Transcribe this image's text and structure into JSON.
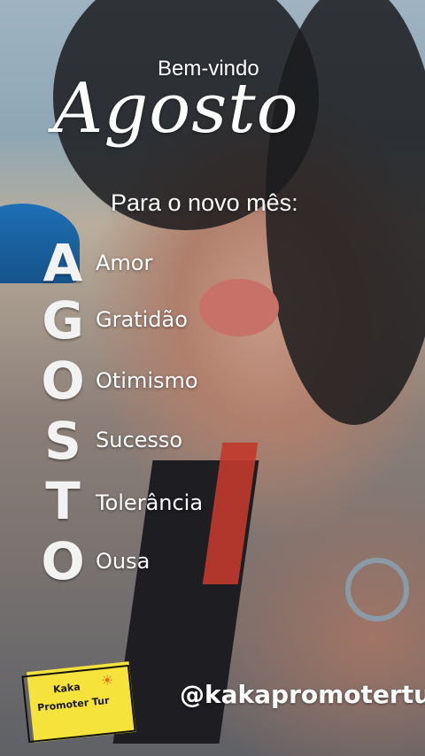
{
  "header": {
    "welcome": "Bem-vindo",
    "month": "Agosto",
    "subtitle": "Para o novo mês:"
  },
  "acrostic": [
    {
      "letter": "A",
      "word": "Amor"
    },
    {
      "letter": "G",
      "word": "Gratidão"
    },
    {
      "letter": "O",
      "word": "Otimismo"
    },
    {
      "letter": "S",
      "word": "Sucesso"
    },
    {
      "letter": "T",
      "word": "Tolerância"
    },
    {
      "letter": "O",
      "word": "Ousa"
    }
  ],
  "footer": {
    "handle": "@kakapromotertur",
    "logo_line1": "Kaka",
    "logo_line2": "Promoter Tur"
  },
  "colors": {
    "text": "#ffffff",
    "logo_yellow": "#f5e23b",
    "sun_orange": "#e0701b"
  },
  "icons": {
    "logo_sun": "sun-icon"
  }
}
